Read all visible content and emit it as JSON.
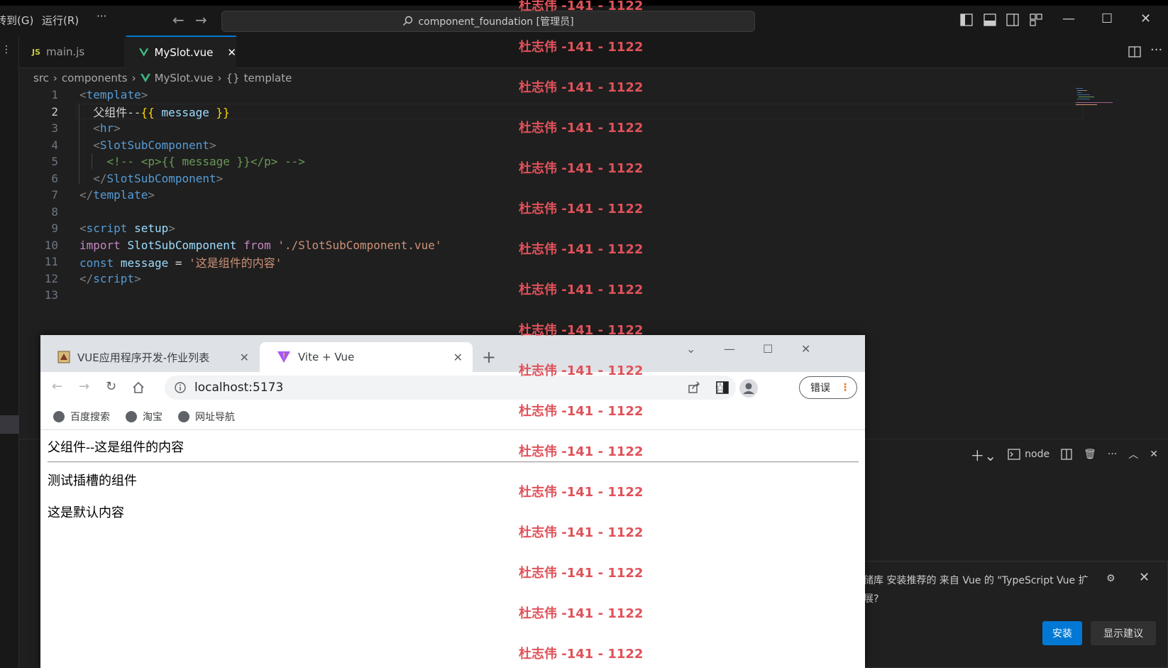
{
  "titlebar": {
    "menu_goto": "转到(G)",
    "menu_run": "运行(R)",
    "menu_more": "···",
    "search_text": "component_foundation [管理员]"
  },
  "editor_tabs": [
    {
      "icon": "JS",
      "label": "main.js"
    },
    {
      "label": "MySlot.vue",
      "close": "✕"
    }
  ],
  "breadcrumb": {
    "parts": [
      "src",
      "components",
      "MySlot.vue",
      "template"
    ],
    "symbol": "{}"
  },
  "code": {
    "line_numbers": [
      "1",
      "2",
      "3",
      "4",
      "5",
      "6",
      "7",
      "8",
      "9",
      "10",
      "11",
      "12",
      "13"
    ],
    "active_line": 2
  },
  "panel": {
    "terminal_name": "node"
  },
  "notification": {
    "message": "储库 安装推荐的 来自 Vue 的 \"TypeScript Vue 扩展?",
    "install_label": "安装",
    "show_label": "显示建议"
  },
  "browser": {
    "tabs": [
      {
        "label": "VUE应用程序开发-作业列表"
      },
      {
        "label": "Vite + Vue"
      }
    ],
    "url": "localhost:5173",
    "error_label": "错误",
    "bookmarks": [
      "百度搜索",
      "淘宝",
      "网址导航"
    ],
    "page": {
      "line1": "父组件--这是组件的内容",
      "line2": "测试插槽的组件",
      "line3": "这是默认内容"
    }
  },
  "watermark": "杜志伟 -141 - 1122",
  "colors": {
    "accent": "#0078d4",
    "watermark": "#e0525a",
    "vue_green": "#41b883"
  }
}
